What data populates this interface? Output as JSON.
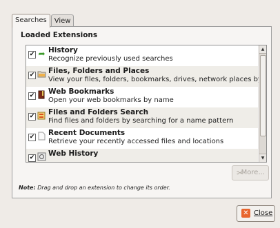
{
  "tabs": [
    {
      "label": "Searches",
      "active": true
    },
    {
      "label": "View",
      "active": false
    }
  ],
  "section_title": "Loaded Extensions",
  "extensions": [
    {
      "name": "History",
      "description": "Recognize previously used searches",
      "checked": true,
      "icon": "green-arrow-icon"
    },
    {
      "name": "Files, Folders and Places",
      "description": "View your files, folders, bookmarks, drives, network places by name",
      "checked": true,
      "icon": "folder-icon"
    },
    {
      "name": "Web Bookmarks",
      "description": "Open your web bookmarks by name",
      "checked": true,
      "icon": "bookmark-icon"
    },
    {
      "name": "Files and Folders Search",
      "description": "Find files and folders by searching for a name pattern",
      "checked": true,
      "icon": "search-folder-icon"
    },
    {
      "name": "Recent Documents",
      "description": "Retrieve your recently accessed files and locations",
      "checked": true,
      "icon": "document-icon"
    },
    {
      "name": "Web History",
      "description": "",
      "checked": true,
      "icon": "globe-history-icon"
    }
  ],
  "more_button": {
    "label": "More...",
    "enabled": false,
    "icon": "tools-icon"
  },
  "note": {
    "prefix": "Note:",
    "text": "Drag and drop an extension to change its order."
  },
  "close_button": {
    "label": "Close",
    "icon": "close-icon"
  }
}
